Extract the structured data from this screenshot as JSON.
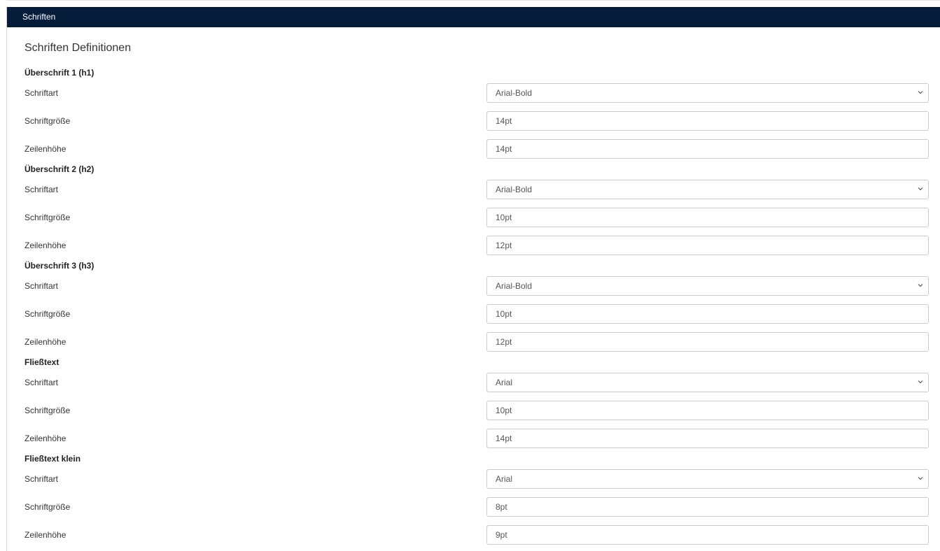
{
  "panel": {
    "header_title": "Schriften",
    "section_title": "Schriften Definitionen"
  },
  "labels": {
    "font": "Schriftart",
    "size": "Schriftgröße",
    "line_height": "Zeilenhöhe"
  },
  "groups": [
    {
      "title": "Überschrift 1 (h1)",
      "font": "Arial-Bold",
      "size": "14pt",
      "line_height": "14pt"
    },
    {
      "title": "Überschrift 2 (h2)",
      "font": "Arial-Bold",
      "size": "10pt",
      "line_height": "12pt"
    },
    {
      "title": "Überschrift 3 (h3)",
      "font": "Arial-Bold",
      "size": "10pt",
      "line_height": "12pt"
    },
    {
      "title": "Fließtext",
      "font": "Arial",
      "size": "10pt",
      "line_height": "14pt"
    },
    {
      "title": "Fließtext klein",
      "font": "Arial",
      "size": "8pt",
      "line_height": "9pt"
    }
  ],
  "icons": {
    "dropdown": "chevron-down-icon"
  },
  "colors": {
    "header_bg": "#051c3a",
    "header_text": "#ffffff",
    "border": "#cccccc"
  }
}
